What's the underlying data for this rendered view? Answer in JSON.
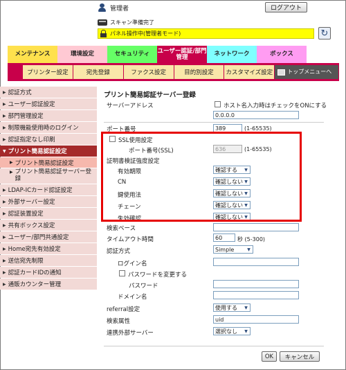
{
  "header": {
    "user_label": "管理者",
    "logout_label": "ログアウト",
    "scan_status": "スキャン準備完了",
    "panel_status": "パネル操作中(管理者モード)"
  },
  "main_tabs": [
    "メンテナンス",
    "環境設定",
    "セキュリティ",
    "ユーザー認証/部門管理",
    "ネットワーク",
    "ボックス"
  ],
  "sub_tabs": [
    "プリンター設定",
    "宛先登録",
    "ファクス設定",
    "目的別設定",
    "カスタマイズ設定",
    "トップメニューへ"
  ],
  "sidebar": {
    "items": [
      "認証方式",
      "ユーザー認証設定",
      "部門管理設定",
      "制限機能使用時のログイン",
      "認証指定なし印刷",
      "プリント簡易認証設定",
      "LDAP-ICカード認証設定",
      "外部サーバー設定",
      "認証装置設定",
      "共有ボックス設定",
      "ユーザー/部門共通設定",
      "Home宛先有効設定",
      "送信宛先制限",
      "認証カードIDの通知",
      "通販カウンター管理"
    ],
    "subitems": [
      "プリント簡易認証設定",
      "プリント簡易認証サーバー登録"
    ]
  },
  "content": {
    "title": "プリント簡易認証サーバー登録",
    "server_address_label": "サーバーアドレス",
    "hostname_checkbox_label": "ホスト名入力時はチェックをONにする",
    "server_address_value": "0.0.0.0",
    "port_label": "ポート番号",
    "port_value": "389",
    "port_range": "(1-65535)",
    "ssl_label": "SSL使用設定",
    "ssl_port_label": "ポート番号(SSL)",
    "ssl_port_value": "636",
    "ssl_port_range": "(1-65535)",
    "cert_label": "証明書検証強度設定",
    "cert_rows": [
      {
        "label": "有効期限",
        "value": "確認する"
      },
      {
        "label": "CN",
        "value": "確認しない"
      },
      {
        "label": "鍵使用法",
        "value": "確認しない"
      },
      {
        "label": "チェーン",
        "value": "確認しない"
      },
      {
        "label": "失効確認",
        "value": "確認しない"
      }
    ],
    "search_base_label": "検索ベース",
    "timeout_label": "タイムアウト時間",
    "timeout_value": "60",
    "timeout_range": "秒 (5-300)",
    "auth_method_label": "認証方式",
    "auth_method_value": "Simple",
    "login_name_label": "ログイン名",
    "change_password_label": "パスワードを変更する",
    "password_label": "パスワード",
    "domain_label": "ドメイン名",
    "referral_label": "referral設定",
    "referral_value": "使用する",
    "search_attr_label": "検索属性",
    "search_attr_value": "uid",
    "linked_server_label": "連携外部サーバー",
    "linked_server_value": "選択なし",
    "ok_label": "OK",
    "cancel_label": "キャンセル"
  },
  "colors": {
    "auth_tab": "#c8004a",
    "highlight_box": "#e60000",
    "panel_bar": "#ffff00"
  }
}
